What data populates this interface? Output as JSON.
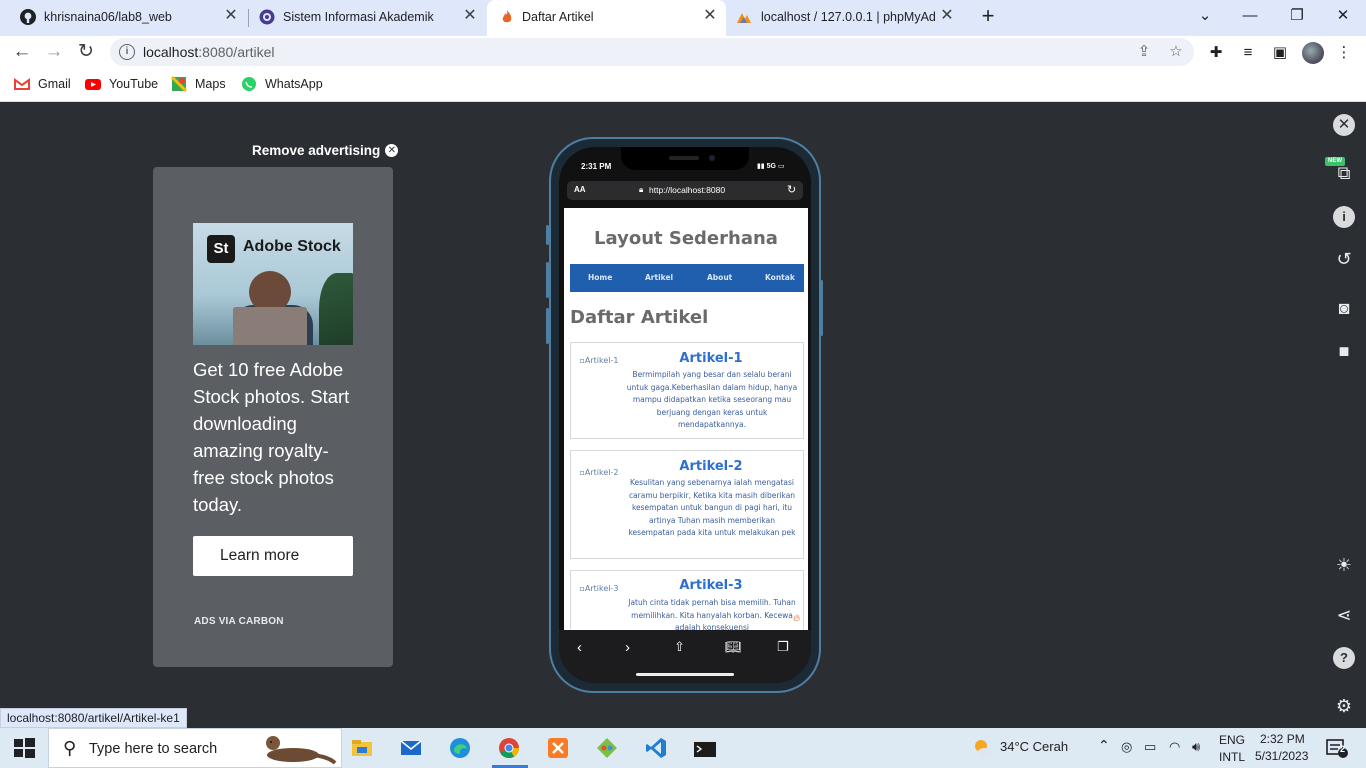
{
  "browser": {
    "tabs": [
      {
        "title": "khrisnaina06/lab8_web",
        "icon": "github-icon"
      },
      {
        "title": "Sistem Informasi Akademik",
        "icon": "academic-icon"
      },
      {
        "title": "Daftar Artikel",
        "icon": "codeigniter-flame-icon",
        "active": true
      },
      {
        "title": "localhost / 127.0.0.1 | phpMyAdmin",
        "icon": "phpmyadmin-icon"
      }
    ],
    "url_host": "localhost",
    "url_rest": ":8080/artikel",
    "bookmarks": [
      {
        "label": "Gmail",
        "icon": "gmail-icon"
      },
      {
        "label": "YouTube",
        "icon": "youtube-icon"
      },
      {
        "label": "Maps",
        "icon": "maps-icon"
      },
      {
        "label": "WhatsApp",
        "icon": "whatsapp-icon"
      }
    ],
    "status_url": "localhost:8080/artikel/Artikel-ke1"
  },
  "ad": {
    "remove_label": "Remove advertising",
    "brand_logo": "St",
    "brand_name": "Adobe Stock",
    "text": "Get 10 free Adobe Stock photos. Start downloading amazing royalty-free stock photos today.",
    "button": "Learn more",
    "via": "ADS VIA CARBON"
  },
  "phone": {
    "time": "2:31 PM",
    "network": "5G",
    "aa": "AA",
    "url": "http://localhost:8080",
    "page": {
      "header": "Layout Sederhana",
      "nav": [
        "Home",
        "Artikel",
        "About",
        "Kontak"
      ],
      "heading": "Daftar Artikel",
      "articles": [
        {
          "img_alt": "Artikel-1",
          "title": "Artikel-1",
          "desc": "Bermimpilah yang besar dan selalu berani untuk gaga.Keberhasilan dalam hidup, hanya mampu didapatkan ketika seseorang mau berjuang dengan keras untuk mendapatkannya."
        },
        {
          "img_alt": "Artikel-2",
          "title": "Artikel-2",
          "desc": "Kesulitan yang sebenarnya ialah mengatasi caramu berpikir, Ketika kita masih diberikan kesempatan untuk bangun di pagi hari, itu artinya Tuhan masih memberikan kesempatan pada kita untuk melakukan pek"
        },
        {
          "img_alt": "Artikel-3",
          "title": "Artikel-3",
          "desc": "Jatuh cinta tidak pernah bisa memilih. Tuhan memilihkan. Kita hanyalah korban. Kecewa adalah konsekuensi"
        }
      ]
    }
  },
  "devtools": {
    "new_badge": "NEW"
  },
  "taskbar": {
    "search_placeholder": "Type here to search",
    "weather": "34°C  Cerah",
    "lang_top": "ENG",
    "lang_bottom": "INTL",
    "time": "2:32 PM",
    "date": "5/31/2023",
    "notification_count": "2"
  }
}
